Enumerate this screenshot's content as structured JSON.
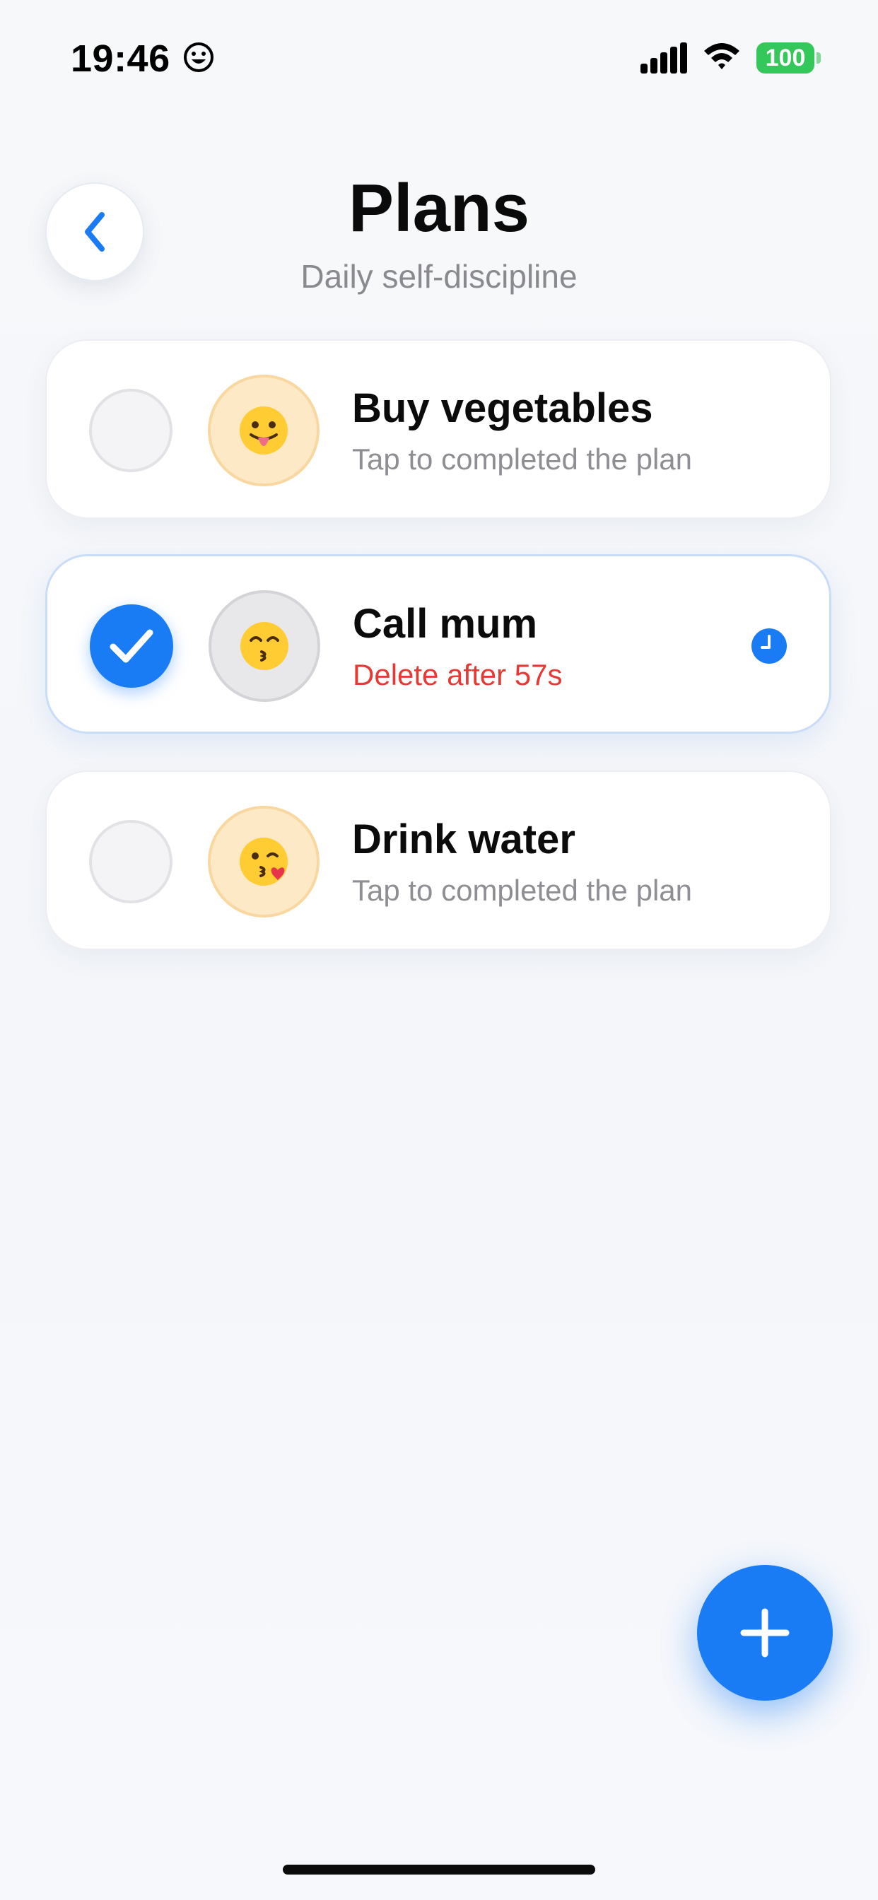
{
  "status_bar": {
    "time": "19:46",
    "battery": "100",
    "icons": [
      "smiley-face-icon",
      "cellular-signal-icon",
      "wifi-icon",
      "battery-icon"
    ]
  },
  "header": {
    "title": "Plans",
    "subtitle": "Daily self-discipline",
    "back_icon": "chevron-left-icon"
  },
  "plans": [
    {
      "title": "Buy vegetables",
      "hint": "Tap to completed the plan",
      "checked": false,
      "emoji": "face-with-tongue-icon"
    },
    {
      "title": "Call mum",
      "hint": "Delete after 57s",
      "checked": true,
      "emoji": "kissing-smiling-eyes-icon",
      "badge_icon": "clock-icon"
    },
    {
      "title": "Drink water",
      "hint": "Tap to completed the plan",
      "checked": false,
      "emoji": "face-blowing-kiss-icon"
    }
  ],
  "fab": {
    "icon": "plus-icon"
  },
  "colors": {
    "accent": "#1a7cf5",
    "danger": "#e53935",
    "battery": "#34c759",
    "muted_text": "#8e8e93"
  }
}
